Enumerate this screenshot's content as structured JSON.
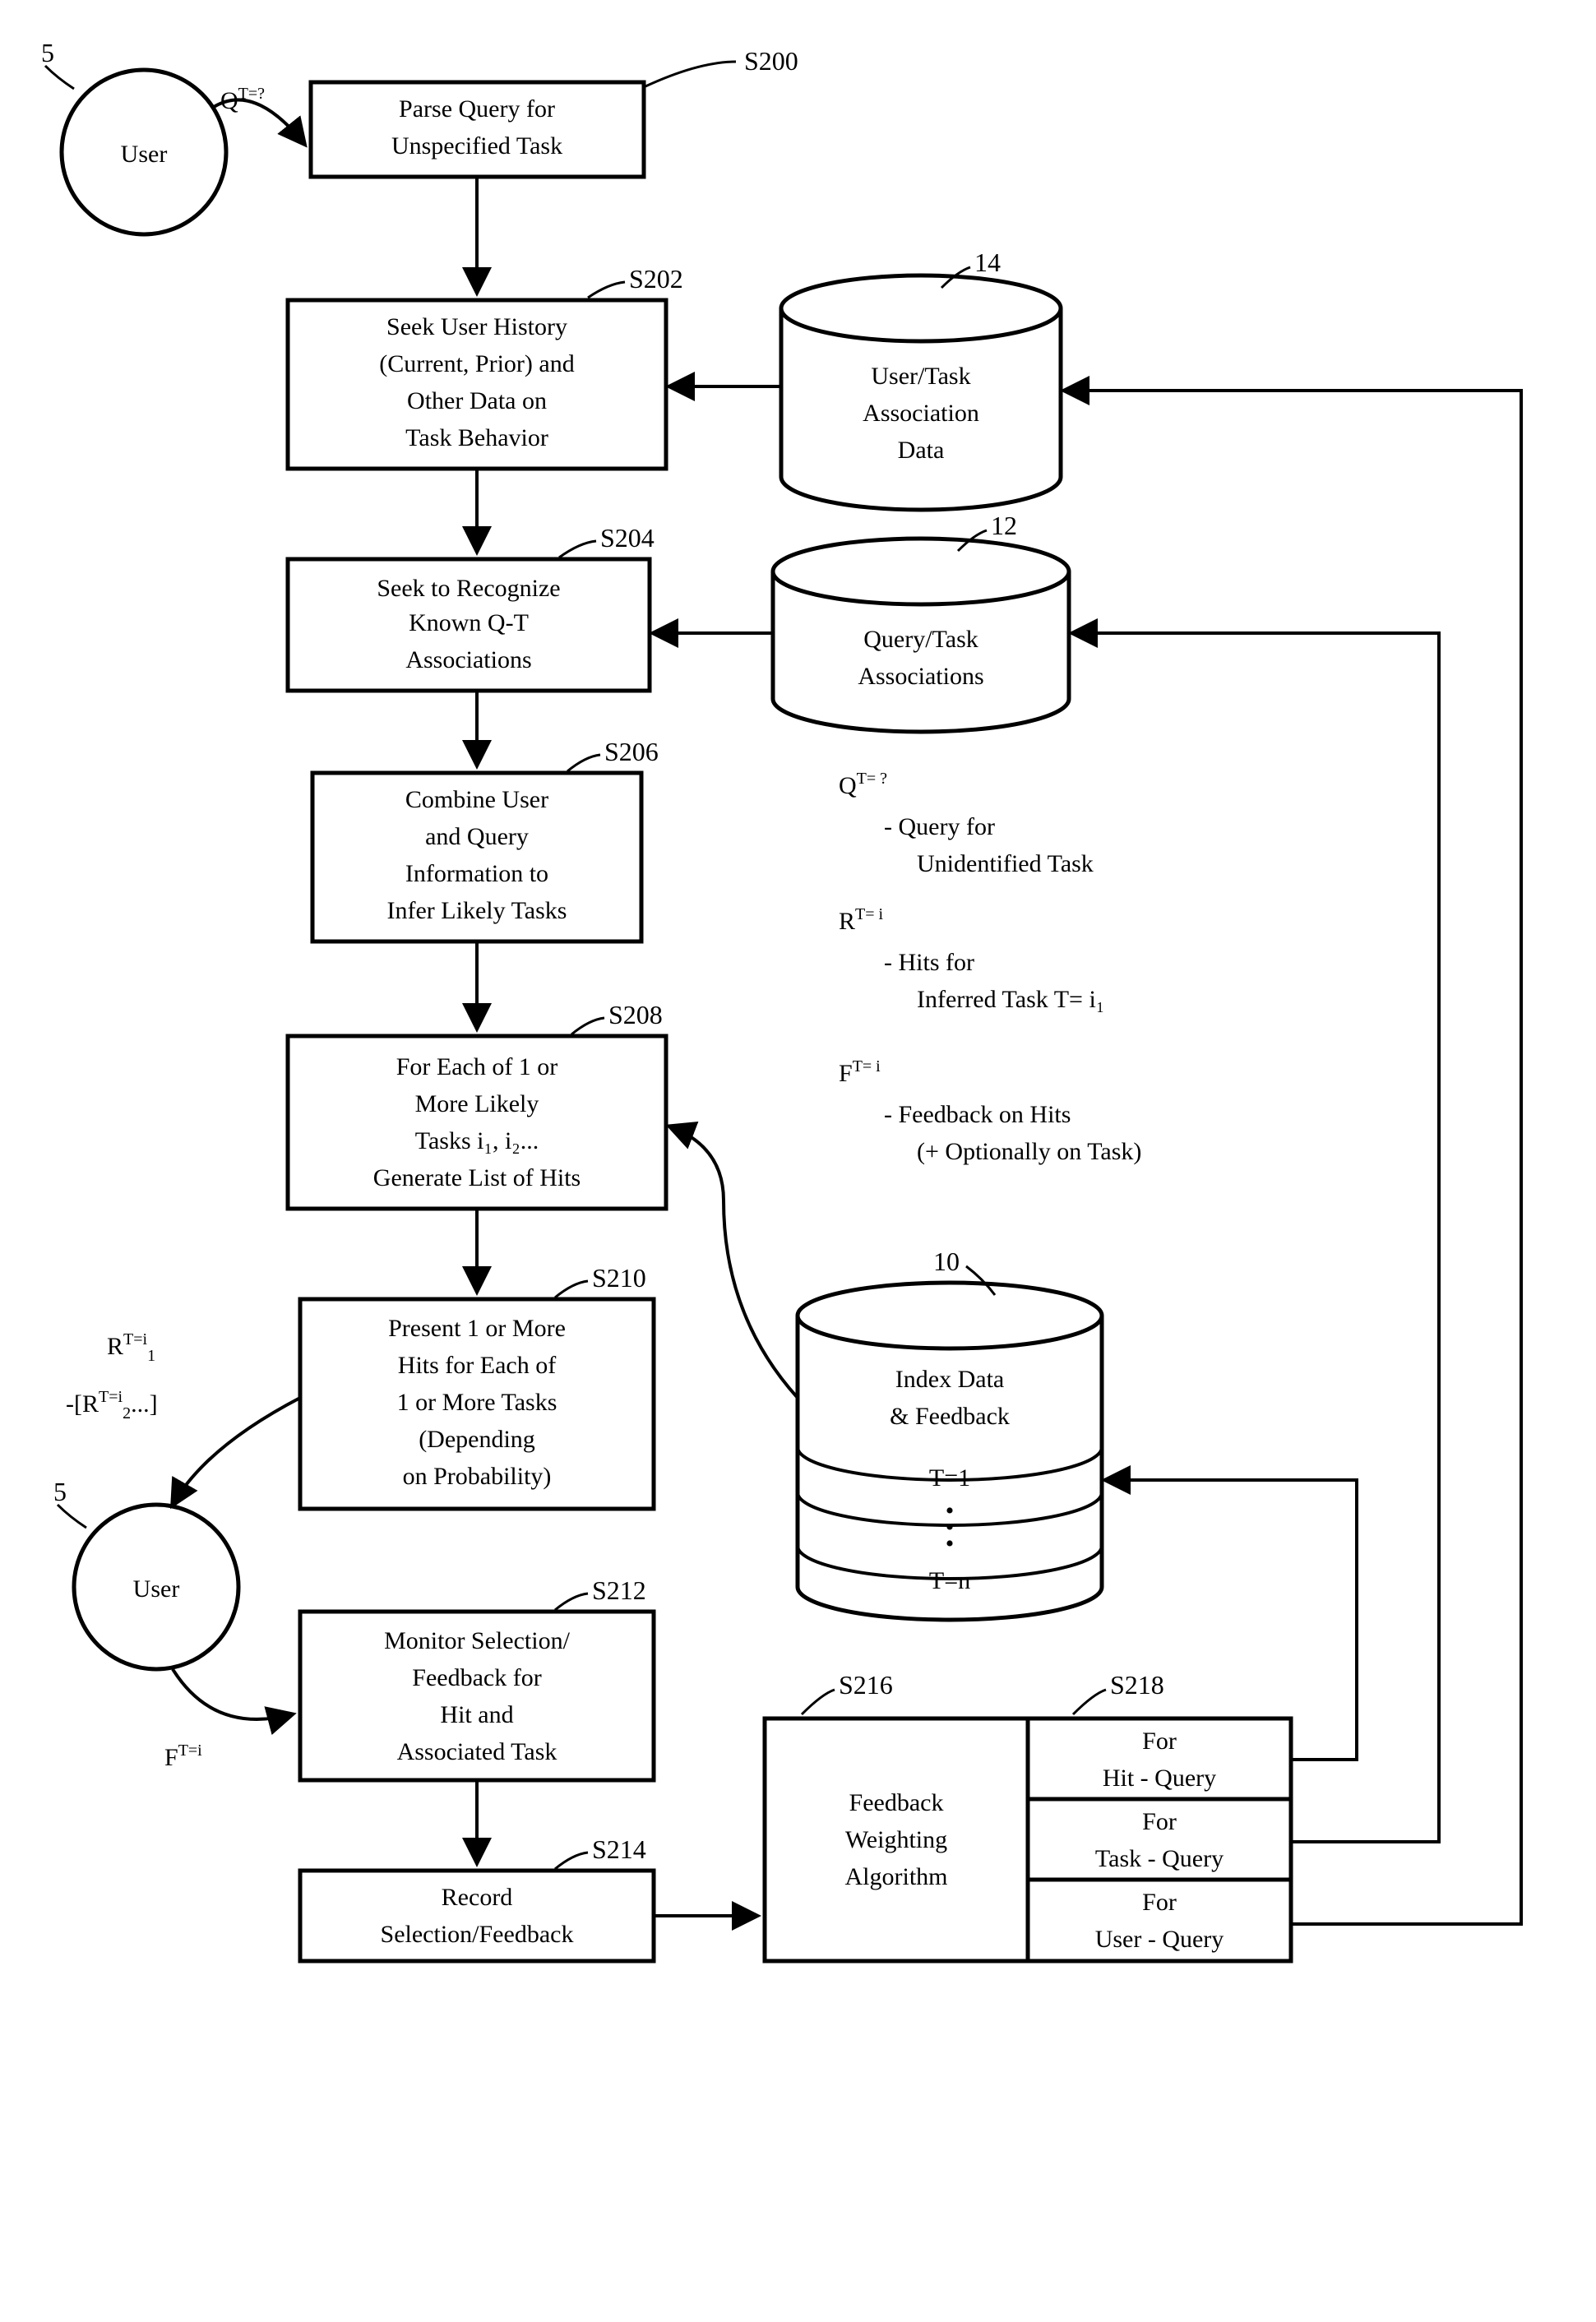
{
  "user_label": "User",
  "user_num_top": "5",
  "user_num_bottom": "5",
  "q_arrow_top": "Q",
  "q_arrow_top_sup": "T=?",
  "s200": {
    "num": "S200",
    "line1": "Parse Query for",
    "line2": "Unspecified Task"
  },
  "s202": {
    "num": "S202",
    "line1": "Seek User History",
    "line2": "(Current, Prior) and",
    "line3": "Other Data on",
    "line4": "Task Behavior"
  },
  "s204": {
    "num": "S204",
    "line1": "Seek to Recognize",
    "line2": "Known Q-T",
    "line3": "Associations"
  },
  "s206": {
    "num": "S206",
    "line1": "Combine User",
    "line2": "and Query",
    "line3": "Information to",
    "line4": "Infer Likely Tasks"
  },
  "s208": {
    "num": "S208",
    "line1": "For Each of 1 or",
    "line2": "More Likely",
    "line3": "Tasks i₁, i₂...",
    "line4": "Generate List of Hits"
  },
  "s210": {
    "num": "S210",
    "line1": "Present 1 or More",
    "line2": "Hits for Each of",
    "line3": "1 or More Tasks",
    "line4": "(Depending",
    "line5": "on Probability)"
  },
  "s212": {
    "num": "S212",
    "line1": "Monitor Selection/",
    "line2": "Feedback for",
    "line3": "Hit and",
    "line4": "Associated Task"
  },
  "s214": {
    "num": "S214",
    "line1": "Record",
    "line2": "Selection/Feedback"
  },
  "db14": {
    "num": "14",
    "line1": "User/Task",
    "line2": "Association",
    "line3": "Data"
  },
  "db12": {
    "num": "12",
    "line1": "Query/Task",
    "line2": "Associations"
  },
  "db10": {
    "num": "10",
    "line1": "Index Data",
    "line2": "& Feedback",
    "slice1": "T=1",
    "slice2": "T=n",
    "dots": "•"
  },
  "legend": {
    "q_sym": "Q",
    "q_sup": "T= ?",
    "q_line1": "- Query for",
    "q_line2": "Unidentified Task",
    "r_sym": "R",
    "r_sup": "T= i",
    "r_line1": "- Hits for",
    "r_line2_a": "Inferred Task ",
    "r_line2_b": "T= i₁",
    "f_sym": "F",
    "f_sup": "T= i",
    "f_line1": "- Feedback on Hits",
    "f_line2": "(+ Optionally on Task)"
  },
  "left_labels": {
    "r1": "R",
    "r1_sup": "T=i",
    "r1_sub": "1",
    "r2_prefix": "-[R",
    "r2_sup": "T=i",
    "r2_sub": "2",
    "r2_suffix": "...]",
    "f": "F",
    "f_sup": "T=i"
  },
  "feedback_alg": {
    "line1": "Feedback",
    "line2": "Weighting",
    "line3": "Algorithm"
  },
  "s216": {
    "num": "S216"
  },
  "s218": {
    "num": "S218"
  },
  "hitq": {
    "line1": "For",
    "line2": "Hit - Query"
  },
  "taskq": {
    "line1": "For",
    "line2": "Task - Query"
  },
  "userq": {
    "line1": "For",
    "line2": "User - Query"
  }
}
